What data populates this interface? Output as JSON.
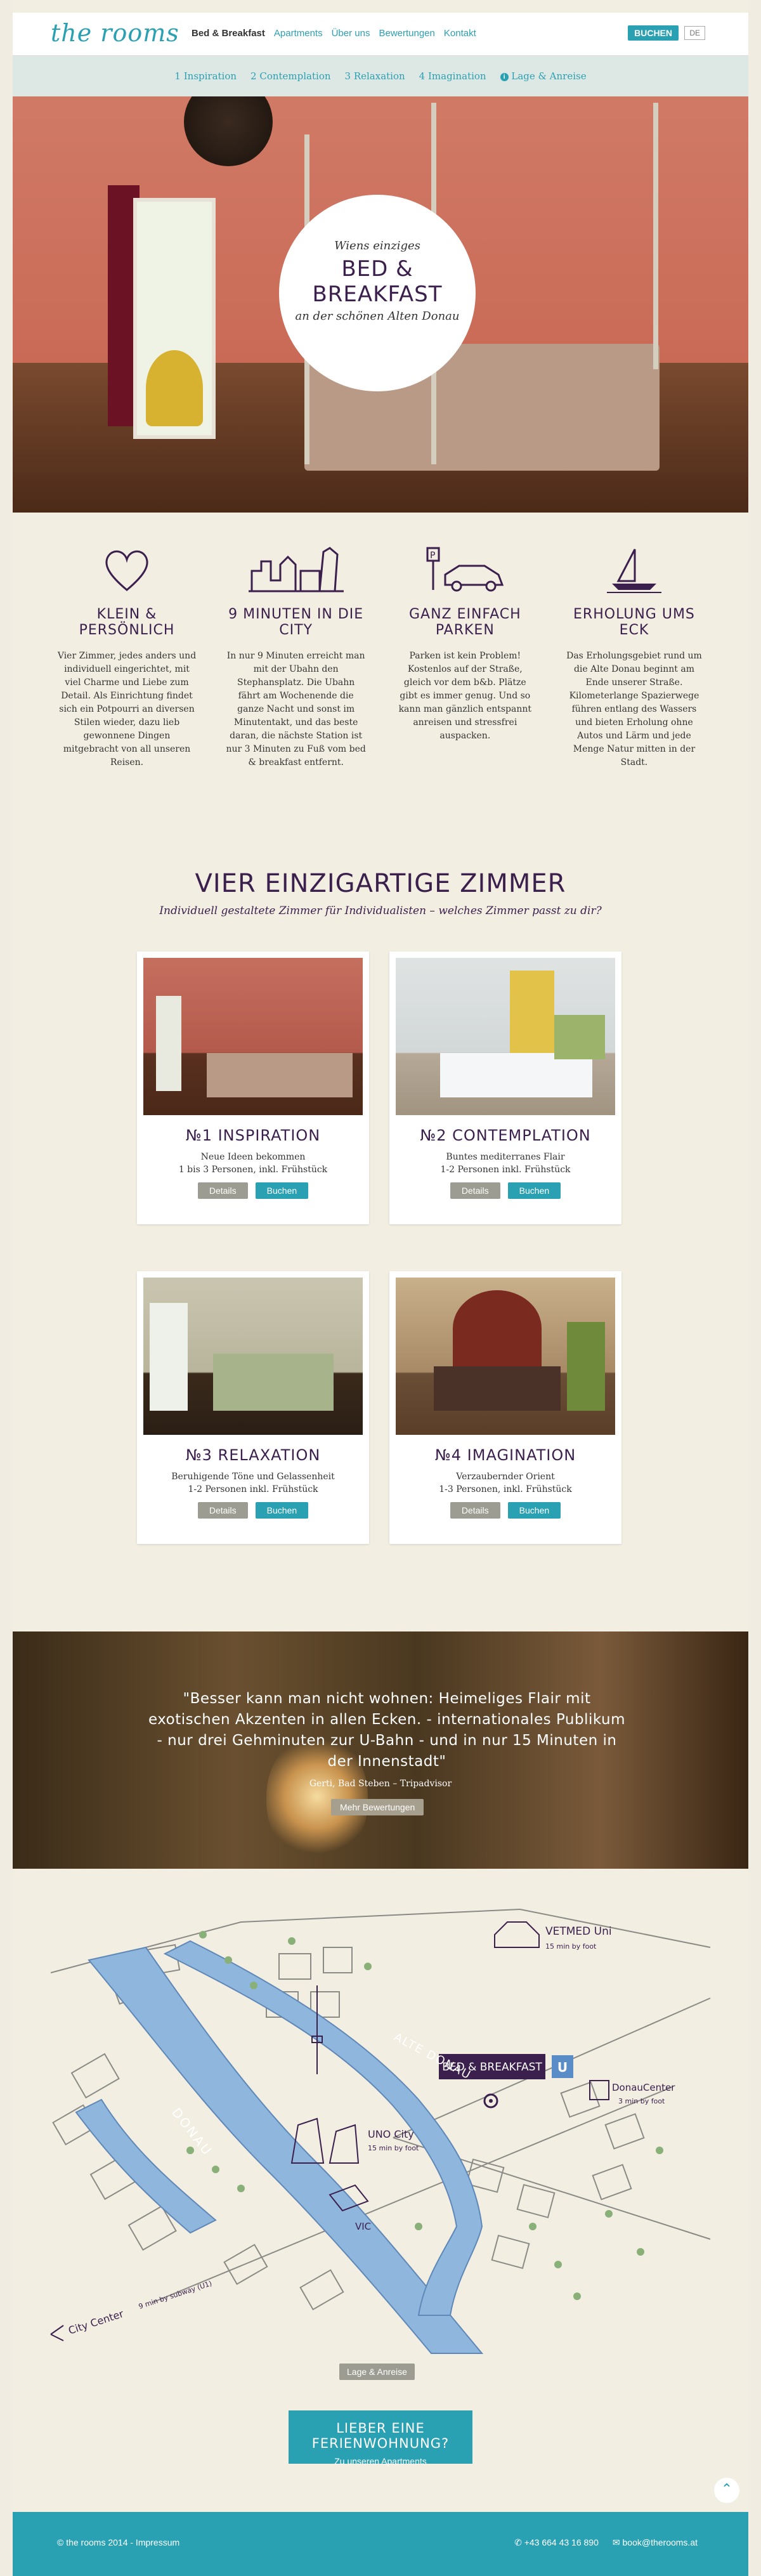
{
  "header": {
    "logo": "the rooms",
    "nav": [
      "Bed & Breakfast",
      "Apartments",
      "Über uns",
      "Bewertungen",
      "Kontakt"
    ],
    "book_button": "BUCHEN",
    "lang": "DE"
  },
  "subnav": [
    "1 Inspiration",
    "2 Contemplation",
    "3 Relaxation",
    "4 Imagination",
    "Lage & Anreise"
  ],
  "hero": {
    "small": "Wiens einziges",
    "big_line1": "BED &",
    "big_line2": "BREAKFAST",
    "sub": "an der schönen Alten Donau"
  },
  "features": [
    {
      "icon": "heart-icon",
      "title": "KLEIN & PERSÖNLICH",
      "text": "Vier Zimmer, jedes anders und individuell eingerichtet, mit viel Charme und Liebe zum Detail. Als Einrichtung findet sich ein Potpourri an diversen Stilen wieder, dazu lieb gewonnene Dingen mitgebracht von all unseren Reisen."
    },
    {
      "icon": "city-icon",
      "title": "9 MINUTEN IN DIE CITY",
      "text": "In nur 9 Minuten erreicht man mit der Ubahn den Stephansplatz. Die Ubahn fährt am Wochenende die ganze Nacht und sonst im Minutentakt, und das beste daran, die nächste Station ist nur 3 Minuten zu Fuß vom bed & breakfast entfernt."
    },
    {
      "icon": "parking-car-icon",
      "title": "GANZ EINFACH PARKEN",
      "text": "Parken ist kein Problem! Kostenlos auf der Straße, gleich vor dem b&b. Plätze gibt es immer genug. Und so kann man gänzlich entspannt anreisen und stressfrei auspacken."
    },
    {
      "icon": "sailboat-icon",
      "title": "ERHOLUNG UMS ECK",
      "text": "Das Erholungsgebiet rund um die Alte Donau beginnt am Ende unserer Straße. Kilometerlange Spazierwege führen entlang des Wassers und bieten Erholung ohne Autos und Lärm und jede Menge Natur mitten in der Stadt."
    }
  ],
  "rooms": {
    "title": "VIER EINZIGARTIGE ZIMMER",
    "subtitle": "Individuell gestaltete Zimmer für Individualisten – welches Zimmer passt zu dir?",
    "details_label": "Details",
    "book_label": "Buchen",
    "items": [
      {
        "title": "№1 INSPIRATION",
        "line1": "Neue Ideen bekommen",
        "line2": "1 bis 3 Personen, inkl. Frühstück"
      },
      {
        "title": "№2 CONTEMPLATION",
        "line1": "Buntes mediterranes Flair",
        "line2": "1-2 Personen inkl. Frühstück"
      },
      {
        "title": "№3 RELAXATION",
        "line1": "Beruhigende Töne und Gelassenheit",
        "line2": "1-2 Personen inkl. Frühstück"
      },
      {
        "title": "№4 IMAGINATION",
        "line1": "Verzaubernder Orient",
        "line2": "1-3 Personen, inkl. Frühstück"
      }
    ]
  },
  "review": {
    "quote": "\"Besser kann man nicht wohnen: Heimeliges Flair mit exotischen Akzenten in allen Ecken. - internationales Publikum - nur drei Gehminuten zur U-Bahn - und in nur 15 Minuten in der Innenstadt\"",
    "author": "Gerti, Bad Steben – Tripadvisor",
    "more_button": "Mehr Bewertungen"
  },
  "map": {
    "river_donau": "DONAU",
    "river_alte_donau": "ALTE DONAU",
    "bnb": "BED & BREAKFAST",
    "ubahn": "U",
    "vetmed": "VETMED Uni",
    "vetmed_time": "15 min by foot",
    "donaucenter": "DonauCenter",
    "donaucenter_time": "3 min by foot",
    "unocity": "UNO City",
    "unocity_time": "15 min by foot",
    "vic": "VIC",
    "citycenter": "City Center",
    "citycenter_time": "9 min by subway (U1)",
    "button": "Lage & Anreise"
  },
  "cta": {
    "line1": "LIEBER EINE FERIENWOHNUNG?",
    "line2": "Zu unseren Apartments"
  },
  "footer": {
    "copyright": "© the rooms 2014 - Impressum",
    "phone": "+43 664 43 16 890",
    "email": "book@therooms.at"
  },
  "colors": {
    "accent": "#2aa1b3",
    "purple": "#3b1f4d",
    "background": "#f2eee2"
  }
}
